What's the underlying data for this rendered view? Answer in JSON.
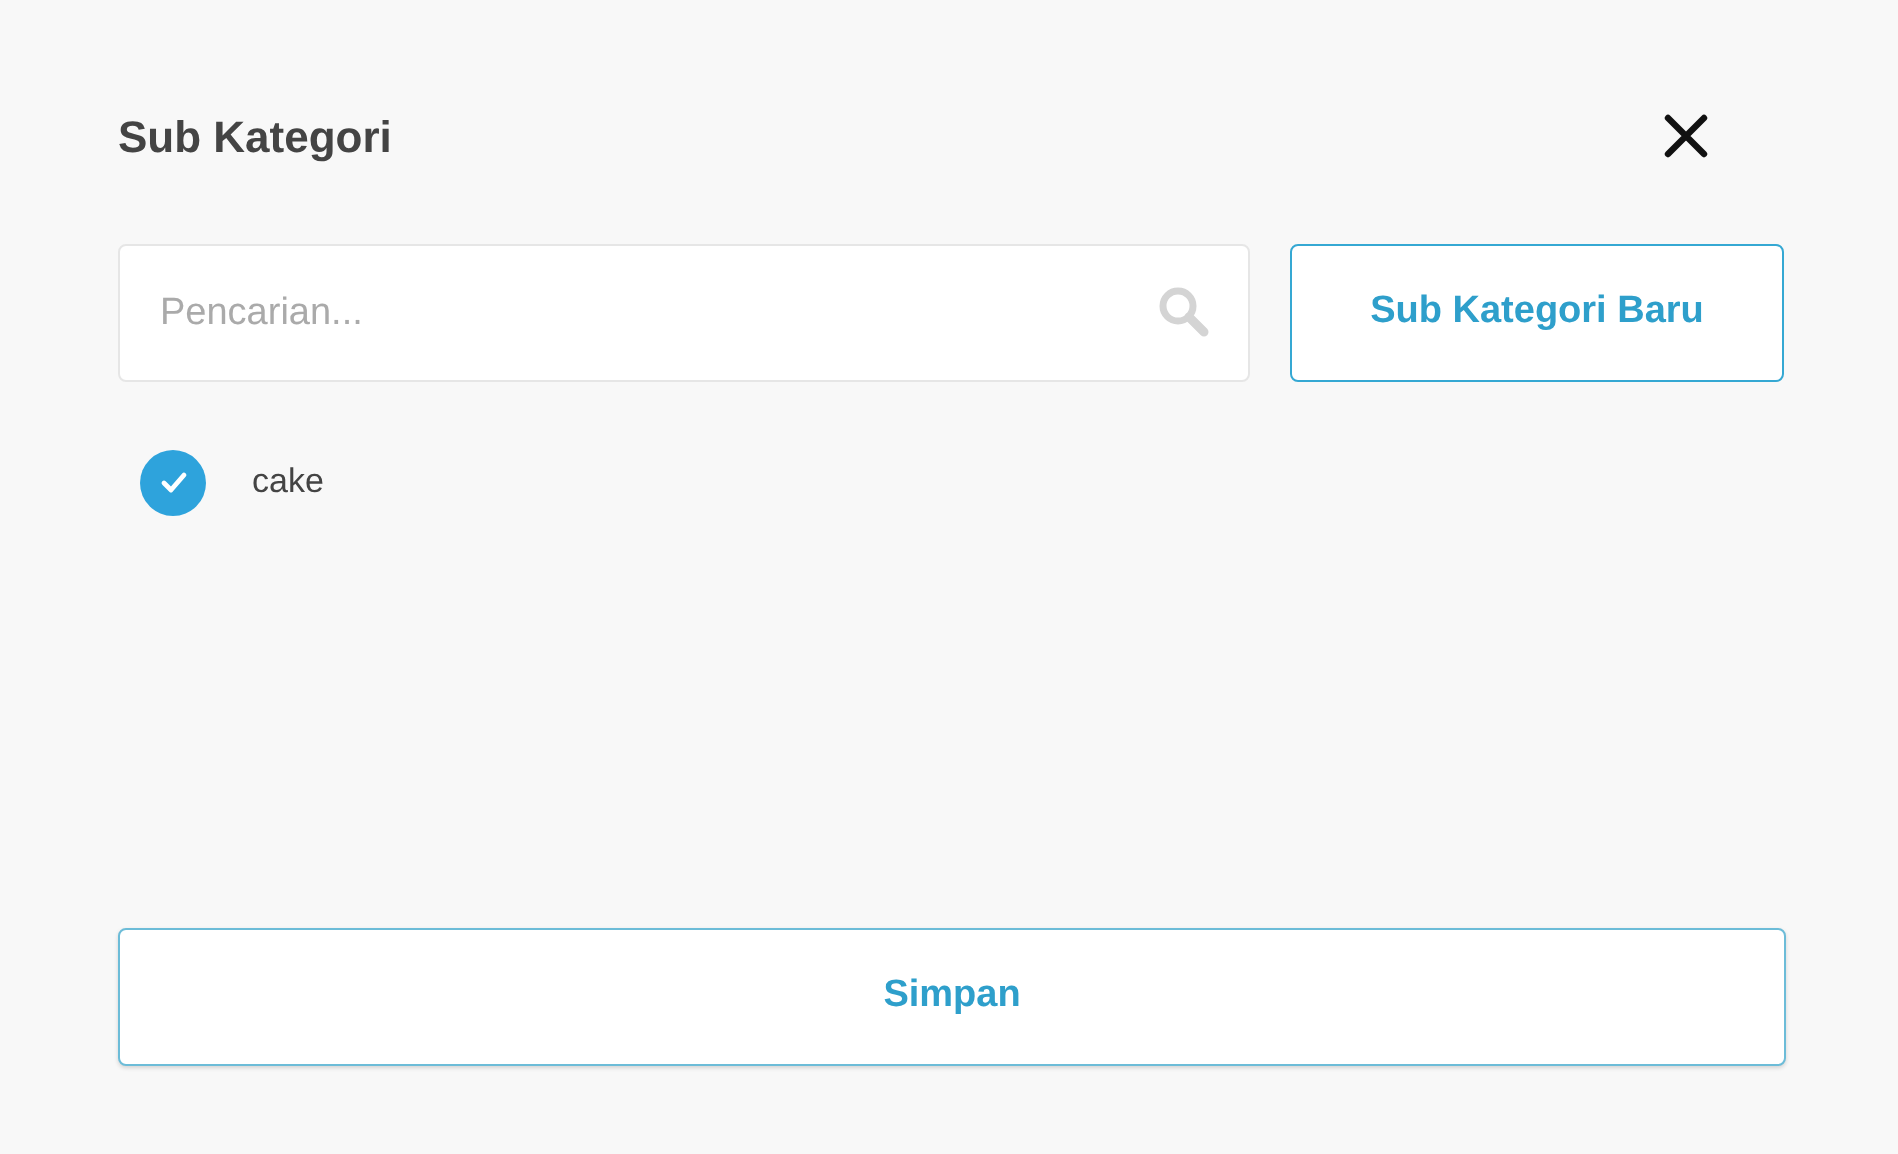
{
  "dialog": {
    "title": "Sub Kategori"
  },
  "search": {
    "placeholder": "Pencarian..."
  },
  "new_button": {
    "label": "Sub Kategori Baru"
  },
  "items": [
    {
      "label": "cake",
      "checked": true
    }
  ],
  "save_button": {
    "label": "Simpan"
  }
}
